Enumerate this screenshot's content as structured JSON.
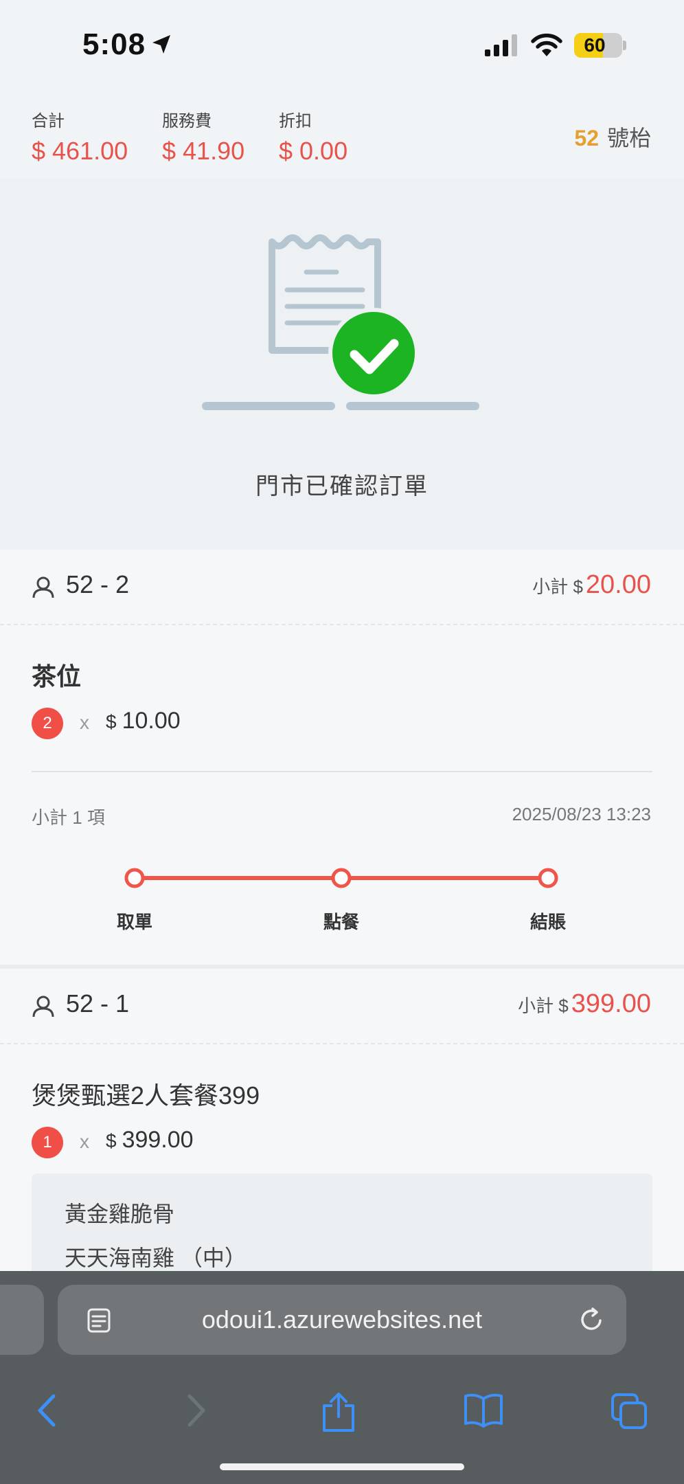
{
  "status_bar": {
    "time": "5:08",
    "battery": "60",
    "battery_level": 0.6
  },
  "totals": {
    "total": {
      "label": "合計",
      "value": "$ 461.00"
    },
    "service": {
      "label": "服務費",
      "value": "$ 41.90"
    },
    "discount": {
      "label": "折扣",
      "value": "$ 0.00"
    },
    "table_number": "52",
    "table_suffix": "號枱"
  },
  "hero": {
    "message": "門市已確認訂單"
  },
  "seat_a": {
    "label": "52 - 2",
    "subtotal_label": "小計 $",
    "subtotal_value": "20.00",
    "item": {
      "name": "茶位",
      "qty": "2",
      "times": "x",
      "currency": "$",
      "price": "10.00"
    },
    "summary": "小計 1 項",
    "timestamp": "2025/08/23 13:23",
    "steps": [
      "取單",
      "點餐",
      "結賬"
    ]
  },
  "seat_b": {
    "label": "52 - 1",
    "subtotal_label": "小計 $",
    "subtotal_value": "399.00",
    "item": {
      "name": "煲煲甄選2人套餐399",
      "qty": "1",
      "times": "x",
      "currency": "$",
      "price": "399.00"
    },
    "options": [
      "黃金雞脆骨",
      "天天海南雞 （中）"
    ]
  },
  "browser": {
    "url": "odoui1.azurewebsites.net"
  },
  "colors": {
    "accent_red": "#e8524a",
    "badge_red": "#f04f47",
    "check_green": "#1db423",
    "table_orange": "#e5a02f",
    "ios_blue": "#3e8ff6"
  }
}
